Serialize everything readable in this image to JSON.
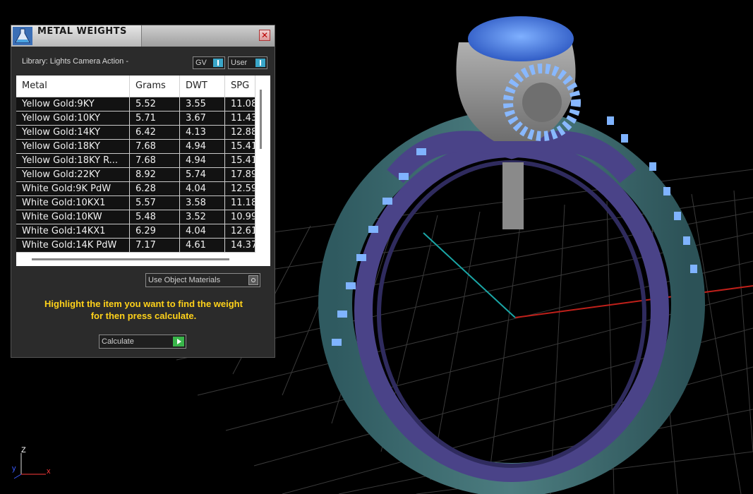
{
  "panel": {
    "title": "METAL WEIGHTS",
    "close_glyph": "✕",
    "library_label": "Library: Lights Camera Action -",
    "gv_toggle": "GV",
    "user_toggle": "User",
    "columns": [
      "Metal",
      "Grams",
      "DWT",
      "SPG"
    ],
    "rows": [
      [
        "Yellow Gold:9KY",
        "5.52",
        "3.55",
        "11.08"
      ],
      [
        "Yellow Gold:10KY",
        "5.71",
        "3.67",
        "11.43"
      ],
      [
        "Yellow Gold:14KY",
        "6.42",
        "4.13",
        "12.88"
      ],
      [
        "Yellow Gold:18KY",
        "7.68",
        "4.94",
        "15.41"
      ],
      [
        "Yellow Gold:18KY R...",
        "7.68",
        "4.94",
        "15.41"
      ],
      [
        "Yellow Gold:22KY",
        "8.92",
        "5.74",
        "17.89"
      ],
      [
        "White Gold:9K PdW",
        "6.28",
        "4.04",
        "12.59"
      ],
      [
        "White Gold:10KX1",
        "5.57",
        "3.58",
        "11.18"
      ],
      [
        "White Gold:10KW",
        "5.48",
        "3.52",
        "10.99"
      ],
      [
        "White Gold:14KX1",
        "6.29",
        "4.04",
        "12.61"
      ],
      [
        "White Gold:14K PdW",
        "7.17",
        "4.61",
        "14.37"
      ]
    ],
    "use_object_materials": "Use Object Materials",
    "hint_line1": "Highlight the item you want to find the weight",
    "hint_line2": "for then press calculate.",
    "calculate_label": "Calculate"
  },
  "viewport": {
    "axis_z": "Z",
    "axis_y": "y",
    "axis_x": "x",
    "colors": {
      "background": "#000000",
      "grid": "#3a3a3a",
      "ring_metal": "#3d6b6e",
      "ring_inner": "#4a4388",
      "gem": "#3b6fd8",
      "x_axis": "#c0201a",
      "y_axis": "#1aa6a6"
    }
  }
}
